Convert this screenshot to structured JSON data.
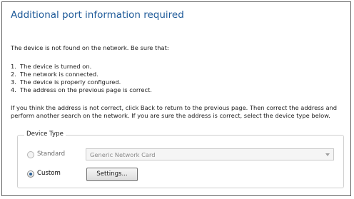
{
  "dialog": {
    "title": "Additional port information required",
    "intro": "The device is not found on the network.  Be sure that:",
    "checklist": [
      {
        "num": "1.",
        "text": "The device is turned on."
      },
      {
        "num": "2.",
        "text": "The network is connected."
      },
      {
        "num": "3.",
        "text": "The device is properly configured."
      },
      {
        "num": "4.",
        "text": "The address on the previous page is correct."
      }
    ],
    "instructions": "If you think the address is not correct, click Back to return to the previous page.  Then correct the address and perform another search on the network.  If you are sure the address is correct, select the device type below."
  },
  "device_type": {
    "group_label": "Device Type",
    "standard": {
      "label": "Standard",
      "checked": false,
      "enabled": false
    },
    "custom": {
      "label": "Custom",
      "checked": true,
      "enabled": true
    },
    "standard_select_value": "Generic Network Card",
    "settings_button_label": "Settings..."
  },
  "icons": {
    "dropdown": "chevron-down-icon"
  },
  "colors": {
    "title": "#1e5a99",
    "radio_selected": "#2a5f96"
  }
}
